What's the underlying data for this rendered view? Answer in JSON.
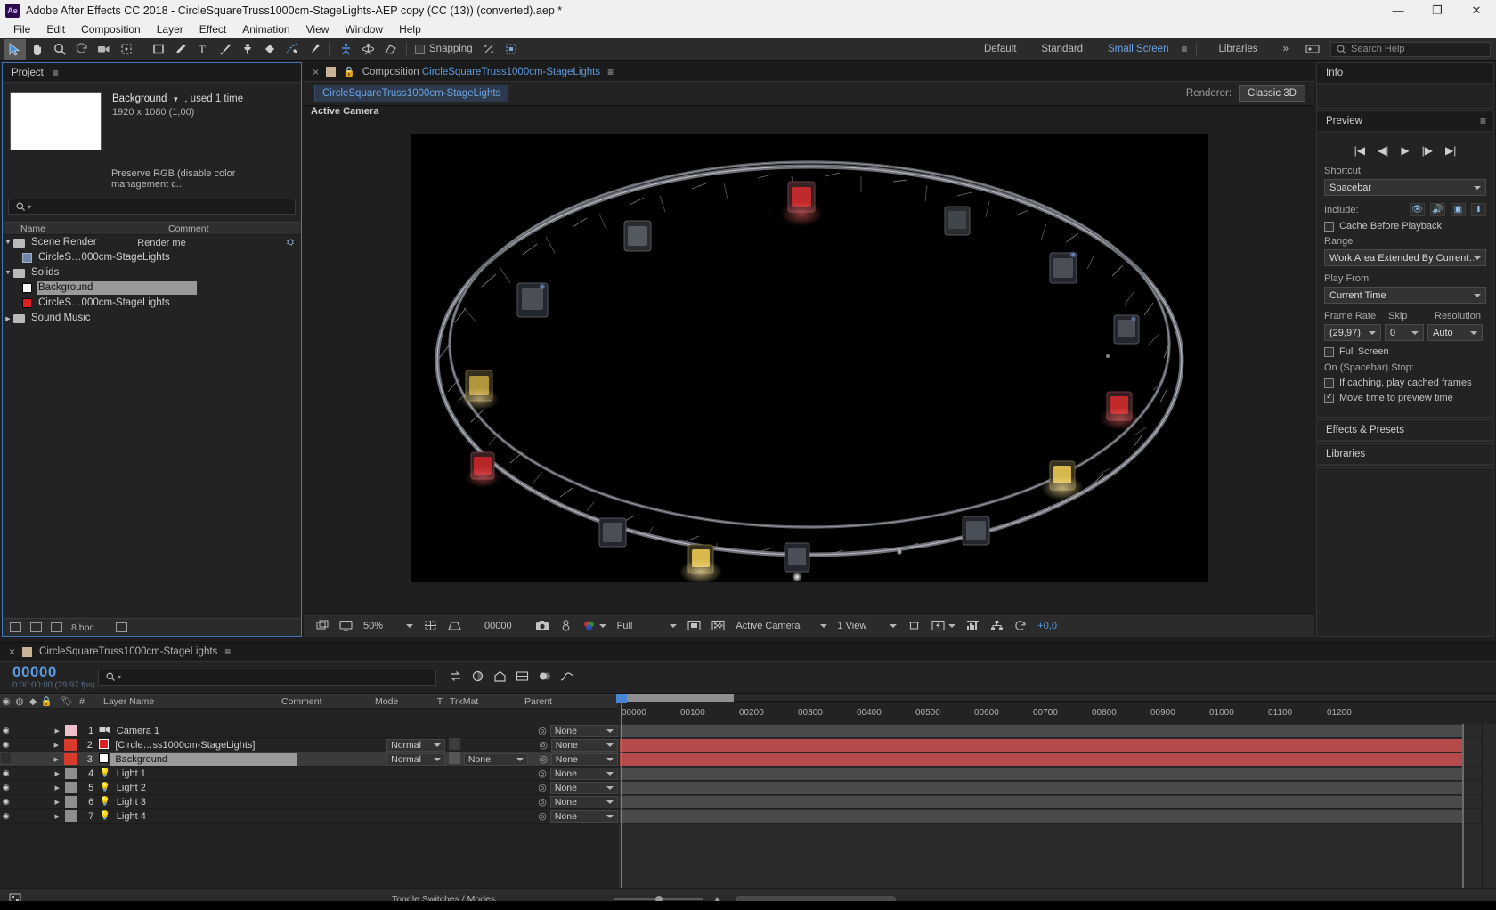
{
  "titlebar": {
    "app_badge": "Ae",
    "title": "Adobe After Effects CC 2018 - CircleSquareTruss1000cm-StageLights-AEP copy (CC (13)) (converted).aep *",
    "minimize": "—",
    "maximize": "❐",
    "close": "✕"
  },
  "menubar": {
    "items": [
      "File",
      "Edit",
      "Composition",
      "Layer",
      "Effect",
      "Animation",
      "View",
      "Window",
      "Help"
    ]
  },
  "toolbar": {
    "tools": [
      {
        "name": "selection-tool-icon",
        "glyph": "➤"
      },
      {
        "name": "hand-tool-icon",
        "glyph": "✋"
      },
      {
        "name": "zoom-tool-icon",
        "glyph": "🔍"
      },
      {
        "name": "rotation-tool-icon",
        "glyph": "↻"
      },
      {
        "name": "camera-tool-icon",
        "glyph": "🎥"
      },
      {
        "name": "pan-behind-tool-icon",
        "glyph": "⛶"
      },
      {
        "name": "shape-tool-icon",
        "glyph": "▢"
      },
      {
        "name": "pen-tool-icon",
        "glyph": "✒"
      },
      {
        "name": "type-tool-icon",
        "glyph": "T"
      },
      {
        "name": "brush-tool-icon",
        "glyph": "🖌"
      },
      {
        "name": "clone-stamp-tool-icon",
        "glyph": "⚒"
      },
      {
        "name": "eraser-tool-icon",
        "glyph": "◆"
      },
      {
        "name": "roto-brush-tool-icon",
        "glyph": "✁"
      },
      {
        "name": "puppet-pin-tool-icon",
        "glyph": "✦"
      }
    ],
    "threed_tools": [
      {
        "name": "unified-camera-tool-icon",
        "glyph": "人"
      },
      {
        "name": "orbit-tool-icon",
        "glyph": "⚲"
      },
      {
        "name": "track-xy-tool-icon",
        "glyph": "⬈"
      }
    ],
    "snapping_label": "Snapping",
    "snap_extra": [
      {
        "name": "snap-options-icon",
        "glyph": "⌖"
      },
      {
        "name": "align-icon",
        "glyph": "⛶"
      }
    ],
    "workspaces": [
      "Default",
      "Standard",
      "Small Screen"
    ],
    "workspace_selected": "Small Screen",
    "libraries_label": "Libraries",
    "overflow": "»",
    "search_placeholder": "Search Help",
    "search_value": "Search Help",
    "accent_blue": "#5e9ae0"
  },
  "project": {
    "tab_label": "Project",
    "asset_name": "Background",
    "asset_usage": ", used 1 time",
    "asset_dims": "1920 x 1080 (1,00)",
    "color_note": "Preserve RGB (disable color management c...",
    "search_placeholder": "",
    "columns": {
      "name": "Name",
      "comment": "Comment"
    },
    "items": [
      {
        "label": "Scene Render",
        "type": "folder",
        "indent": 0,
        "expanded": true,
        "comment": "Render me",
        "selected": false,
        "swatch": "#b9b9b9"
      },
      {
        "label": "CircleS…000cm-StageLights",
        "type": "comp",
        "indent": 1,
        "expanded": false,
        "comment": "",
        "selected": false,
        "swatch": "#6f86a8"
      },
      {
        "label": "Solids",
        "type": "folder",
        "indent": 0,
        "expanded": true,
        "comment": "",
        "selected": false,
        "swatch": "#b9b9b9"
      },
      {
        "label": "Background",
        "type": "solid",
        "indent": 1,
        "expanded": false,
        "comment": "",
        "selected": true,
        "swatch": "#ffffff"
      },
      {
        "label": "CircleS…000cm-StageLights",
        "type": "solid",
        "indent": 1,
        "expanded": false,
        "comment": "",
        "selected": false,
        "swatch": "#e02020"
      },
      {
        "label": "Sound Music",
        "type": "folder",
        "indent": 0,
        "expanded": false,
        "comment": "",
        "selected": false,
        "swatch": "#b9b9b9"
      }
    ],
    "footer_bpc": "8 bpc"
  },
  "composition": {
    "tab_prefix": "Composition",
    "tab_name": "CircleSquareTruss1000cm-StageLights",
    "breadcrumb": "CircleSquareTruss1000cm-StageLights",
    "renderer_label": "Renderer:",
    "renderer_value": "Classic 3D",
    "active_camera_label": "Active Camera",
    "viewer": {
      "magnification": "50%",
      "timecode": "00000",
      "resolution": "Full",
      "view_camera": "Active Camera",
      "views": "1 View",
      "exposure": "+0,0"
    }
  },
  "info_panel": {
    "title": "Info"
  },
  "preview_panel": {
    "title": "Preview",
    "transport": [
      {
        "name": "first-frame-icon",
        "glyph": "|◀"
      },
      {
        "name": "prev-frame-icon",
        "glyph": "◀|"
      },
      {
        "name": "play-icon",
        "glyph": "▶"
      },
      {
        "name": "next-frame-icon",
        "glyph": "|▶"
      },
      {
        "name": "last-frame-icon",
        "glyph": "▶|"
      }
    ],
    "shortcut_label": "Shortcut",
    "shortcut_value": "Spacebar",
    "include_label": "Include:",
    "include_icons": [
      {
        "name": "video-include-icon",
        "glyph": "👁"
      },
      {
        "name": "audio-include-icon",
        "glyph": "🔊"
      },
      {
        "name": "overlays-include-icon",
        "glyph": "▣"
      },
      {
        "name": "external-monitor-icon",
        "glyph": "⬆"
      }
    ],
    "cache_before_playback": "Cache Before Playback",
    "cache_checked": false,
    "range_label": "Range",
    "range_value": "Work Area Extended By Current…",
    "play_from_label": "Play From",
    "play_from_value": "Current Time",
    "frame_rate_label": "Frame Rate",
    "skip_label": "Skip",
    "resolution_label": "Resolution",
    "frame_rate_value": "(29,97)",
    "skip_value": "0",
    "resolution_value": "Auto",
    "full_screen_label": "Full Screen",
    "full_screen_checked": false,
    "on_stop_label": "On (Spacebar) Stop:",
    "if_caching_label": "If caching, play cached frames",
    "if_caching_checked": false,
    "move_time_label": "Move time to preview time",
    "move_time_checked": true
  },
  "effects_panel": {
    "title": "Effects & Presets"
  },
  "libraries_panel": {
    "title": "Libraries"
  },
  "timeline": {
    "tab_name": "CircleSquareTruss1000cm-StageLights",
    "current_time_big": "00000",
    "current_time_small": "0:00:00:00 (29.97 fps)",
    "search_placeholder": "",
    "switch_icons": [
      {
        "name": "live-update-icon",
        "glyph": "⇄"
      },
      {
        "name": "draft-3d-icon",
        "glyph": "◔"
      },
      {
        "name": "hide-shy-layers-icon",
        "glyph": "⌂"
      },
      {
        "name": "frame-blending-icon",
        "glyph": "▤"
      },
      {
        "name": "motion-blur-icon",
        "glyph": "◍"
      },
      {
        "name": "graph-editor-icon",
        "glyph": "⌁"
      }
    ],
    "columns": [
      "A/V",
      "Label",
      "#",
      "Layer Name",
      "Comment",
      "Mode",
      "T",
      "TrkMat",
      "Parent"
    ],
    "column_labels": {
      "layer_name": "Layer Name",
      "comment": "Comment",
      "mode": "Mode",
      "t": "T",
      "trkmat": "TrkMat",
      "parent": "Parent"
    },
    "ruler_ticks": [
      "00000",
      "00100",
      "00200",
      "00300",
      "00400",
      "00500",
      "00600",
      "00700",
      "00800",
      "00900",
      "01000",
      "01100",
      "01200"
    ],
    "layers": [
      {
        "num": "1",
        "name": "Camera 1",
        "label_color": "#f0c0c8",
        "kind": "camera",
        "mode": "",
        "trkmat": "",
        "parent": "None",
        "visible": true,
        "selected": false,
        "bar_color": "#4a4a4a"
      },
      {
        "num": "2",
        "name": "[Circle…ss1000cm-StageLights]",
        "label_color": "#d83a2e",
        "kind": "solid",
        "mode": "Normal",
        "trkmat": "",
        "parent": "None",
        "visible": true,
        "selected": false,
        "bar_color": "#b44a4a"
      },
      {
        "num": "3",
        "name": "Background",
        "label_color": "#d83a2e",
        "kind": "solid",
        "mode": "Normal",
        "trkmat": "None",
        "parent": "None",
        "visible": false,
        "selected": true,
        "bar_color": "#b44a4a"
      },
      {
        "num": "4",
        "name": "Light 1",
        "label_color": "#8f8f8f",
        "kind": "light",
        "mode": "",
        "trkmat": "",
        "parent": "None",
        "visible": true,
        "selected": false,
        "bar_color": "#4a4a4a"
      },
      {
        "num": "5",
        "name": "Light 2",
        "label_color": "#8f8f8f",
        "kind": "light",
        "mode": "",
        "trkmat": "",
        "parent": "None",
        "visible": true,
        "selected": false,
        "bar_color": "#4a4a4a"
      },
      {
        "num": "6",
        "name": "Light 3",
        "label_color": "#8f8f8f",
        "kind": "light",
        "mode": "",
        "trkmat": "",
        "parent": "None",
        "visible": true,
        "selected": false,
        "bar_color": "#4a4a4a"
      },
      {
        "num": "7",
        "name": "Light 4",
        "label_color": "#8f8f8f",
        "kind": "light",
        "mode": "",
        "trkmat": "",
        "parent": "None",
        "visible": true,
        "selected": false,
        "bar_color": "#4a4a4a"
      }
    ],
    "footer_toggle": "Toggle Switches / Modes"
  }
}
